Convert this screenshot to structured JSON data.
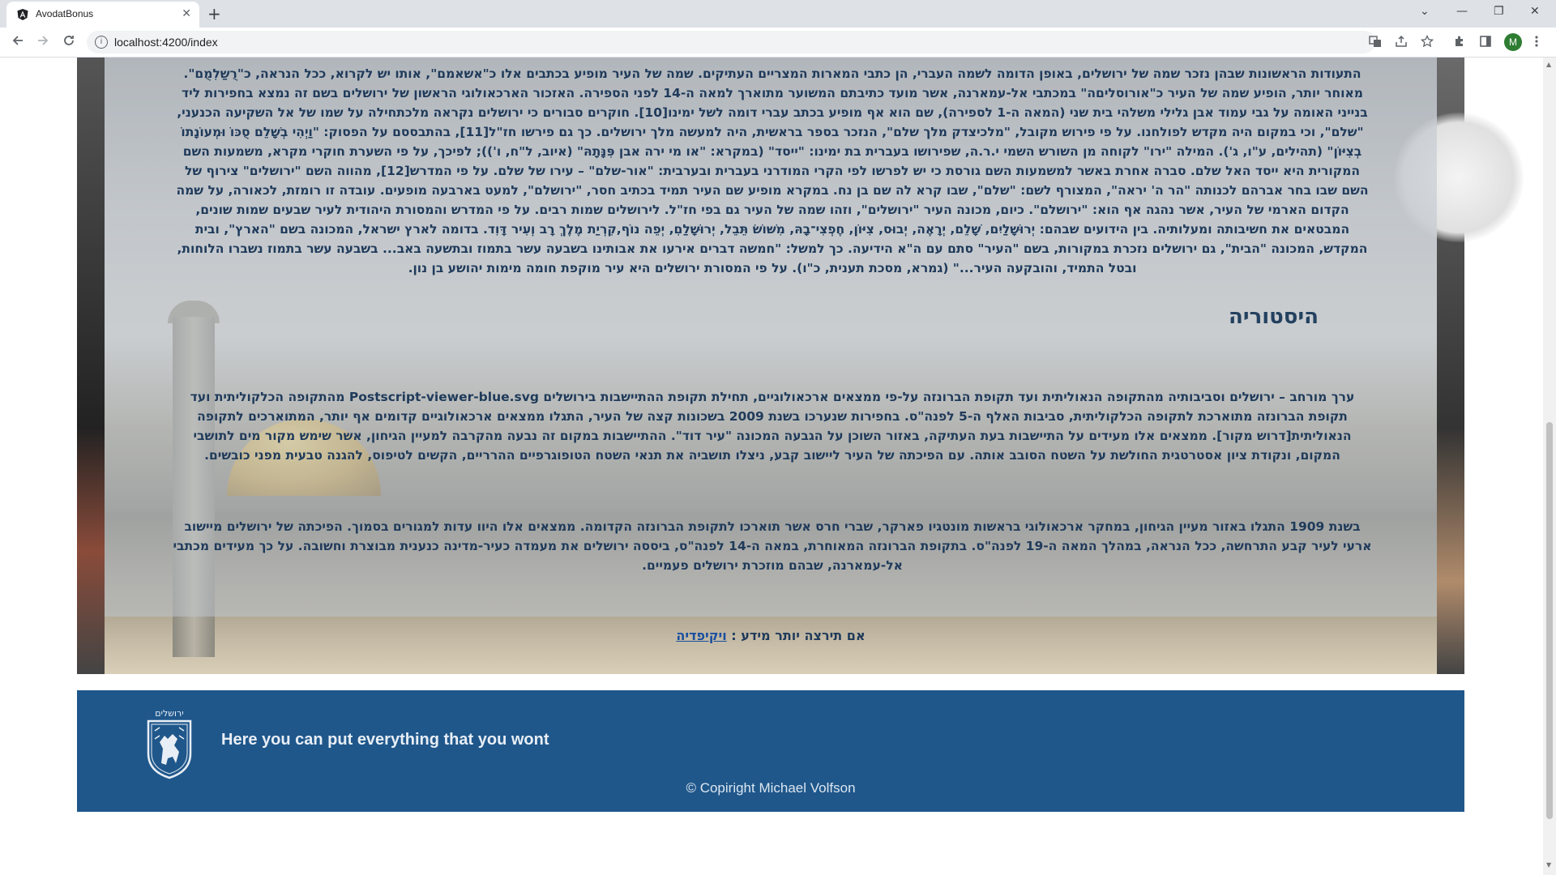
{
  "browser": {
    "tab_title": "AvodatBonus",
    "tab_close": "✕",
    "new_tab": "+",
    "url": "localhost:4200/index",
    "minimize": "—",
    "restore": "❐",
    "close": "✕",
    "dropdown": "⌄",
    "profile_initial": "M",
    "icons": [
      "back-icon",
      "forward-icon",
      "reload-icon",
      "info-icon",
      "translate-icon",
      "share-icon",
      "star-icon",
      "extensions-icon",
      "sidepanel-icon",
      "menu-icon"
    ]
  },
  "article": {
    "intro_paragraph": "התעודות הראשונות שבהן נזכר שמה של ירושלים, באופן הדומה לשמה העברי, הן כתבי המארות המצריים העתיקים. שמה של העיר מופיע בכתבים אלו כ\"אשאמם\", אותו יש לקרוא, ככל הנראה, כ\"רֻשַלִמֻם\". מאוחר יותר, הופיע שמה של העיר כ\"אורוסליםה\" במכתבי אל-עמארנה, אשר מועד כתיבתם המשוער מתוארך למאה ה-14 לפני הספירה. האזכור הארכאולוגי הראשון של ירושלים בשם זה נמצא בחפירות ליד בנייני האומה על גבי עמוד אבן גלילי משלהי בית שני (המאה ה-1 לספירה), שם הוא אף מופיע בכתב עברי דומה לשל ימינו[10]. חוקרים סבורים כי ירושלים נקראה מלכתחילה על שמו של אל השקיעה הכנעני, \"שלם\", וכי במקום היה מקדש לפולחנו. על פי פירוש מקובל, \"מלכיצדק מלך שלם\", הנזכר בספר בראשית, היה למעשה מלך ירושלים. כך גם פירשו חז\"ל[11], בהתבססם על הפסוק: \"וַיְהִי בְשָׁלֵם סֻכּוֹ וּמְעוֹנָתוֹ בְצִיּוֹן\" (תהילים, ע\"ו, ג'). המילה \"ירו\" לקוחה מן השורש השמי י.ר.ה, שפירושו בעברית בת ימינו: \"ייסד\" (במקרא: \"או מי ירה אבן פִּנָּתָהּ\" (איוב, ל\"ח, ו')); לפיכך, על פי השערת חוקרי מקרא, משמעות השם המקורית היא ייסד האל שלם. סברה אחרת באשר למשמעות השם גורסת כי יש לפרשו לפי הקרי המודרני בעברית ובערבית: \"אור-שלם\" – עירו של שלם. על פי המדרש[12], מהווה השם \"ירושלים\" צירוף של השם שבו בחר אברהם לכנותה \"הר ה' יראה\", המצורף לשם: \"שלם\", שבו קרא לה שם בן נח. במקרא מופיע שם העיר תמיד בכתיב חסר, \"ירושלם\", למעט בארבעה מופעים. עובדה זו רומזת, לכאורה, על שמה הקדום הארמי של העיר, אשר נהגה אף הוא: \"ירושלם\". כיום, מכונה העיר \"ירושלים\", וזהו שמה של העיר גם בפי חז\"ל. לירושלים שמות רבים. על פי המדרש והמסורת היהודית לעיר שבעים שמות שונים, המבטאים את חשיבותה ומעלותיה. בין הידועים שבהם: יְרוּשָׁלַיִם, שָׁלֵם, יְרָאֶה, יְבוּס, צִיּוֹן, חֶפְצִי־בָהּ, מִשּׁוֹשׂ תֵּבֵל, יְרוּשָׁלַםִ, יְפֵה נוֹף,קִרְיַת מֶלֶךְ רָב וְעִיר דָּוִד. בדומה לארץ ישראל, המכונה בשם \"הארץ\", ובית המקדש, המכונה \"הבית\", גם ירושלים נזכרת במקורות, בשם \"העיר\" סתם עם ה\"א הידיעה. כך למשל: \"חמשה דברים אירעו את אבותינו בשבעה עשר בתמוז ובתשעה באב... בשבעה עשר בתמוז נשברו הלוחות, ובטל התמיד, והובקעה העיר...\" (גמרא, מסכת תענית, כ\"ו). על פי המסורת ירושלים היא עיר מוקפת חומה מימות יהושע בן נון.",
    "section_title": "היסטוריה",
    "history_paragraph_1": "ערך מורחב – ירושלים וסביבותיה מהתקופה הנאוליתית ועד תקופת הברונזה על-פי ממצאים ארכאולוגיים, תחילת תקופת ההתיישבות בירושלים Postscript-viewer-blue.svg מהתקופה הכלקוליתית ועד תקופת הברונזה מתוארכת לתקופה הכלקוליתית, סביבות האלף ה-5 לפנה\"ס. בחפירות שנערכו בשנת 2009 בשכונות קצה של העיר, התגלו ממצאים ארכאולוגיים קדומים אף יותר, המתוארכים לתקופה הנאוליתית[דרוש מקור]. ממצאים אלו מעידים על התיישבות בעת העתיקה, באזור השוכן על הגבעה המכונה \"עיר דוד\". ההתיישבות במקום זה נבעה מהקרבה למעיין הגיחון, אשר שימש מקור מים לתושבי המקום, ונקודת ציון אסטרטגית החולשת על השטח הסובב אותה. עם הפיכתה של העיר ליישוב קבע, ניצלו תושביה את תנאי השטח הטופוגרפיים ההרריים, הקשים לטיפוס, להגנה טבעית מפני כובשים.",
    "history_paragraph_2": "בשנת 1909 התגלו באזור מעיין הגיחון, במחקר ארכאולוגי בראשות מונטגיו פארקר, שברי חרס אשר תוארכו לתקופת הברונזה הקדומה. ממצאים אלו היוו עדות למגורים בסמוך. הפיכתה של ירושלים מיישוב ארעי לעיר קבע התרחשה, ככל הנראה, במהלך המאה ה-19 לפנה\"ס. בתקופת הברונזה המאוחרת, במאה ה-14 לפנה\"ס, ביססה ירושלים את מעמדה כעיר-מדינה כנענית מבוצרת וחשובה. על כך מעידים מכתבי אל-עמארנה, שבהם מוזכרת ירושלים פעמיים.",
    "more_info_prefix": "אם תירצה יותר מידע :",
    "more_info_link": "ויקיפדיה"
  },
  "footer": {
    "crest_label": "ירושלים",
    "tagline": "Here you can put everything that you wont",
    "copyright": "© Copiright Michael Volfson"
  },
  "colors": {
    "footer_bg": "#1f578b",
    "text_primary": "#1f3a5a",
    "link": "#1a4fa0"
  }
}
